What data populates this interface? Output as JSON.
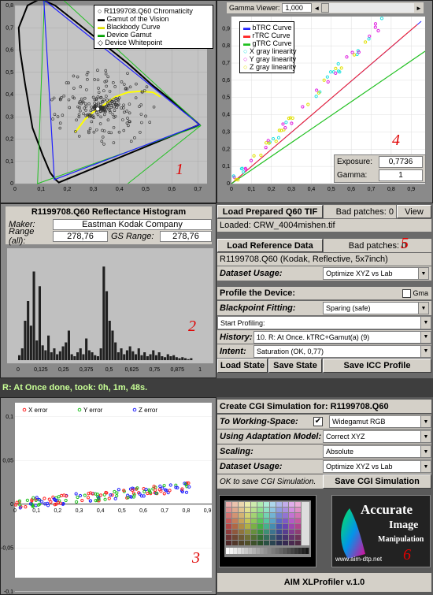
{
  "chromaticity": {
    "legend": [
      "R1199708.Q60 Chromaticity",
      "Gamut of the Vision",
      "Blackbody Curve",
      "Device Gamut",
      "Device Whitepoint"
    ],
    "x_ticks": [
      "0",
      "0,1",
      "0,2",
      "0,3",
      "0,4",
      "0,5",
      "0,6",
      "0,7"
    ],
    "y_ticks": [
      "0,8",
      "0,7",
      "0,6",
      "0,5",
      "0,4",
      "0,3",
      "0,2",
      "0,1",
      "0"
    ],
    "marker": "1"
  },
  "gamma": {
    "label": "Gamma Viewer:",
    "value": "1,000",
    "legend": [
      "bTRC Curve",
      "rTRC Curve",
      "gTRC Curve",
      "X gray linearity",
      "Y gray linearity",
      "Z gray linearity"
    ],
    "x_ticks": [
      "0",
      "0,1",
      "0,2",
      "0,3",
      "0,4",
      "0,5",
      "0,6",
      "0,7",
      "0,8",
      "0,9"
    ],
    "y_ticks": [
      "0,9",
      "0,8",
      "0,7",
      "0,6",
      "0,5",
      "0,4",
      "0,3",
      "0,2",
      "0,1",
      "0"
    ],
    "exposure_label": "Exposure:",
    "exposure_value": "0,7736",
    "gamma_label": "Gamma:",
    "gamma_value": "1",
    "marker": "4"
  },
  "histogram": {
    "title": "R1199708.Q60 Reflectance Histogram",
    "maker_label": "Maker:",
    "maker_value": "Eastman Kodak Company",
    "range_all_label": "Range (all):",
    "range_all_value": "278,76",
    "gs_range_label": "GS Range:",
    "gs_range_value": "278,76",
    "x_ticks": [
      "0",
      "0,125",
      "0,25",
      "0,375",
      "0,5",
      "0,625",
      "0,75",
      "0,875",
      "1"
    ],
    "marker": "2"
  },
  "load_q60": {
    "button": "Load Prepared Q60 TIF",
    "bad_patches": "Bad patches: 0",
    "view_button": "View",
    "loaded": "Loaded: CRW_4004mishen.tif"
  },
  "reference": {
    "button": "Load Reference Data",
    "bad_patches": "Bad patches: 0",
    "description": "R1199708.Q60 (Kodak, Reflective, 5x7inch)",
    "dataset_label": "Dataset Usage:",
    "dataset_value": "Optimize XYZ vs Lab",
    "marker": "5"
  },
  "profile": {
    "title": "Profile the Device:",
    "gma_label": "Gma",
    "blackpoint_label": "Blackpoint Fitting:",
    "blackpoint_value": "Sparing (safe)",
    "start_value": "Start Profiling:",
    "history_label": "History:",
    "history_value": "10. R: At Once. kTRC+Gamut(a) (9)",
    "intent_label": "Intent:",
    "intent_value": "Saturation (OK, 0,77)",
    "load_state": "Load State",
    "save_state": "Save State",
    "save_icc": "Save ICC Profile"
  },
  "status": "R: At Once done, took: 0h, 1m, 48s.",
  "errors": {
    "legend": [
      "X error",
      "Y error",
      "Z error"
    ],
    "x_ticks": [
      "0",
      "0,1",
      "0,2",
      "0,3",
      "0,4",
      "0,5",
      "0,6",
      "0,7",
      "0,8",
      "0,9"
    ],
    "y_ticks": [
      "0,1",
      "0,05",
      "0",
      "-0,05",
      "-0,1"
    ],
    "marker": "3"
  },
  "cgi": {
    "title": "Create CGI Simulation for: R1199708.Q60",
    "working_label": "To Working-Space:",
    "working_value": "Widegamut RGB",
    "adaptation_label": "Using Adaptation Model:",
    "adaptation_value": "Correct XYZ",
    "scaling_label": "Scaling:",
    "scaling_value": "Absolute",
    "dataset_label": "Dataset Usage:",
    "dataset_value": "Optimize XYZ vs Lab",
    "ok_text": "OK to save CGI Simulation.",
    "save_button": "Save CGI Simulation"
  },
  "logo": {
    "line1": "Accurate",
    "line2": "Image",
    "line3": "Manipulation",
    "url": "www.aim-dtp.net",
    "marker": "6"
  },
  "footer": "AIM XLProfiler v.1.0",
  "colors": {
    "blue": "#2020ff",
    "red": "#ff2020",
    "green": "#20c020",
    "yellow": "#ffff00",
    "cyan": "#20e0e0",
    "magenta": "#e020e0"
  }
}
